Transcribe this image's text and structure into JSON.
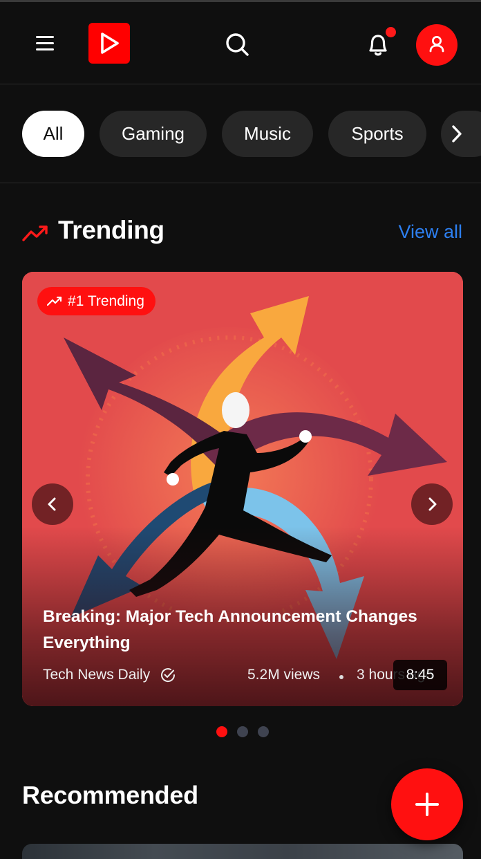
{
  "header": {
    "menu_icon": "hamburger-menu-icon",
    "logo_icon": "play-logo-icon",
    "search_icon": "search-icon",
    "notification_icon": "bell-icon",
    "has_unread_notifications": true,
    "avatar_icon": "user-icon",
    "accent_color": "#ff0000"
  },
  "chips": {
    "items": [
      {
        "label": "All",
        "active": true
      },
      {
        "label": "Gaming",
        "active": false
      },
      {
        "label": "Music",
        "active": false
      },
      {
        "label": "Sports",
        "active": false
      }
    ],
    "next_icon": "chevron-right-icon"
  },
  "trending": {
    "icon": "trending-up-icon",
    "title": "Trending",
    "view_all": "View all",
    "featured": {
      "badge": "#1 Trending",
      "title": "Breaking: Major Tech Announcement Changes Everything",
      "channel": "Tech News Daily",
      "verified": true,
      "views": "5.2M views",
      "age": "3 hours ago",
      "duration": "8:45"
    },
    "carousel": {
      "count": 3,
      "active_index": 0
    }
  },
  "recommended": {
    "title": "Recommended"
  },
  "fab": {
    "icon": "plus-icon"
  }
}
